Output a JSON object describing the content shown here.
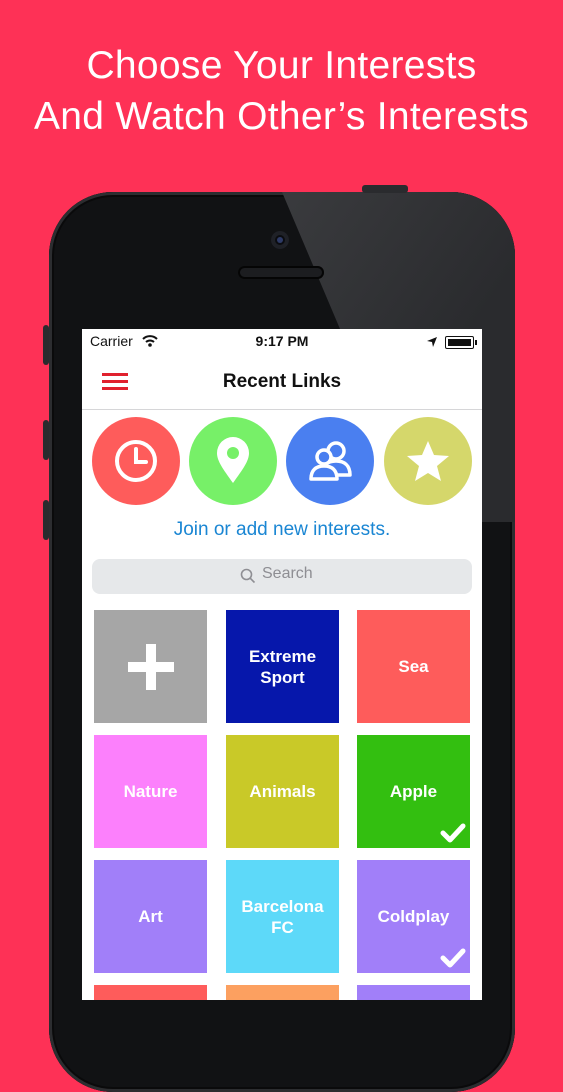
{
  "headline": {
    "line1": "Choose Your Interests",
    "line2": "And Watch Other’s Interests"
  },
  "status_bar": {
    "carrier": "Carrier",
    "time": "9:17 PM"
  },
  "navbar": {
    "title": "Recent Links",
    "menu_icon": "hamburger-menu-icon"
  },
  "quick_actions": [
    {
      "icon": "clock-icon",
      "color": "#fe5c5b"
    },
    {
      "icon": "location-pin-icon",
      "color": "#77f068"
    },
    {
      "icon": "people-icon",
      "color": "#4a7ff0"
    },
    {
      "icon": "star-icon",
      "color": "#d5d76b"
    }
  ],
  "join_text": "Join or add new interests.",
  "search": {
    "placeholder": "Search"
  },
  "interests": [
    {
      "label": "",
      "icon": "plus-icon",
      "color": "#a6a6a6",
      "selected": false
    },
    {
      "label": "Extreme\nSport",
      "color": "#0617ab",
      "selected": false
    },
    {
      "label": "Sea",
      "color": "#fe5c5b",
      "selected": false
    },
    {
      "label": "Nature",
      "color": "#fc80fc",
      "selected": false
    },
    {
      "label": "Animals",
      "color": "#c9c928",
      "selected": false
    },
    {
      "label": "Apple",
      "color": "#33bf10",
      "selected": true
    },
    {
      "label": "Art",
      "color": "#a17ff9",
      "selected": false
    },
    {
      "label": "Barcelona\nFC",
      "color": "#5dd9f9",
      "selected": false
    },
    {
      "label": "Coldplay",
      "color": "#a17ff9",
      "selected": true
    },
    {
      "label": "",
      "color": "#fe5c5b",
      "selected": false
    },
    {
      "label": "",
      "color": "#fca060",
      "selected": false
    },
    {
      "label": "",
      "color": "#a17ff9",
      "selected": false
    }
  ],
  "colors": {
    "background": "#fe3156",
    "accent": "#e0212e",
    "link": "#1a86d3"
  }
}
